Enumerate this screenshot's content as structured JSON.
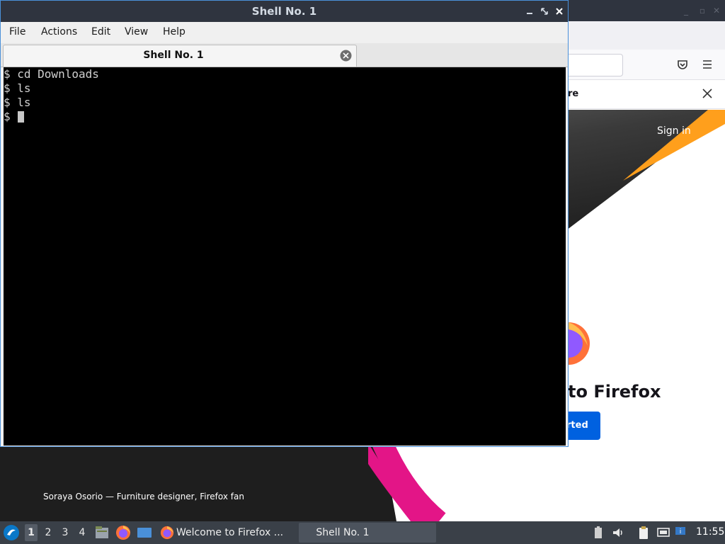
{
  "firefox": {
    "notice_text": "re",
    "sign_in": "Sign in",
    "heading": "to Firefox",
    "get_started": "rted",
    "caption": "Soraya Osorio — Furniture designer, Firefox fan"
  },
  "terminal": {
    "title": "Shell No. 1",
    "menu": {
      "file": "File",
      "actions": "Actions",
      "edit": "Edit",
      "view": "View",
      "help": "Help"
    },
    "tab_label": "Shell No. 1",
    "lines": [
      "$ cd Downloads",
      "$ ls",
      "$ ls",
      "$ "
    ]
  },
  "taskbar": {
    "workspaces": [
      "1",
      "2",
      "3",
      "4"
    ],
    "active_workspace": "1",
    "firefox_task": "Welcome to Firefox ...",
    "shell_task": "Shell No. 1",
    "clock": "11:55"
  },
  "colors": {
    "titlebar": "#2f343f",
    "terminal_bg": "#000000",
    "accent_border": "#4a90d9",
    "ff_orange": "#ff9f1c",
    "ff_pink": "#e31587",
    "ff_blue": "#0061e0",
    "taskbar": "#3a4048"
  },
  "icons": {
    "start": "lubuntu-start-icon",
    "file_manager": "file-manager-icon",
    "firefox": "firefox-icon",
    "desktop": "show-desktop-icon",
    "tray": [
      "battery-icon",
      "volume-icon",
      "clipboard-icon",
      "network-icon",
      "update-notifier-icon"
    ]
  }
}
